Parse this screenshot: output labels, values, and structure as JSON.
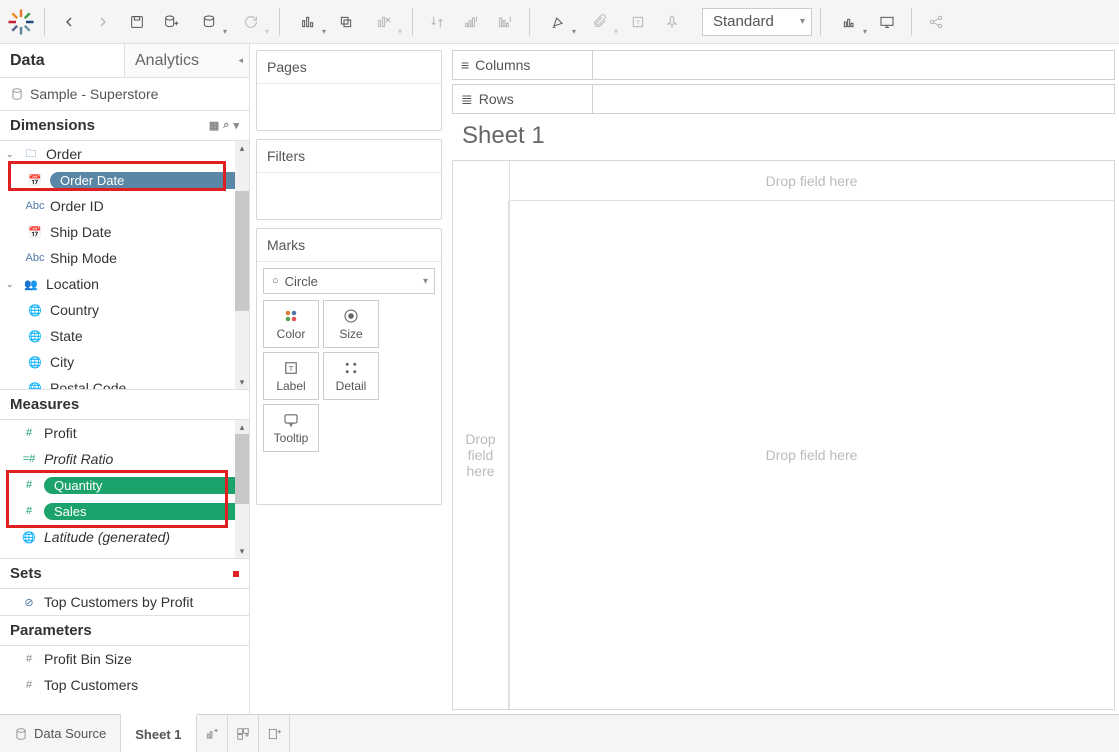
{
  "toolbar": {
    "fit_mode": "Standard"
  },
  "sidebar": {
    "tab_data": "Data",
    "tab_analytics": "Analytics",
    "datasource": "Sample - Superstore",
    "dimensions_label": "Dimensions",
    "measures_label": "Measures",
    "sets_label": "Sets",
    "parameters_label": "Parameters",
    "groups": {
      "order": "Order",
      "location": "Location"
    },
    "dims": {
      "order_date": "Order Date",
      "order_id": "Order ID",
      "ship_date": "Ship Date",
      "ship_mode": "Ship Mode",
      "country": "Country",
      "state": "State",
      "city": "City",
      "postal_code": "Postal Code"
    },
    "meas": {
      "profit": "Profit",
      "profit_ratio": "Profit Ratio",
      "quantity": "Quantity",
      "sales": "Sales",
      "latitude": "Latitude (generated)"
    },
    "sets": {
      "top_customers": "Top Customers by Profit"
    },
    "params": {
      "profit_bin": "Profit Bin Size",
      "top_customers": "Top Customers"
    }
  },
  "cards": {
    "pages": "Pages",
    "filters": "Filters",
    "marks": "Marks",
    "mark_type": "Circle",
    "color": "Color",
    "size": "Size",
    "label": "Label",
    "detail": "Detail",
    "tooltip": "Tooltip"
  },
  "shelves": {
    "columns": "Columns",
    "rows": "Rows"
  },
  "sheet": {
    "title": "Sheet 1",
    "drop_col": "Drop field here",
    "drop_row": "Drop field here",
    "drop_center": "Drop field here"
  },
  "bottom": {
    "datasource": "Data Source",
    "sheet1": "Sheet 1"
  },
  "multiline_placeholder": "Drop\nfield\nhere"
}
